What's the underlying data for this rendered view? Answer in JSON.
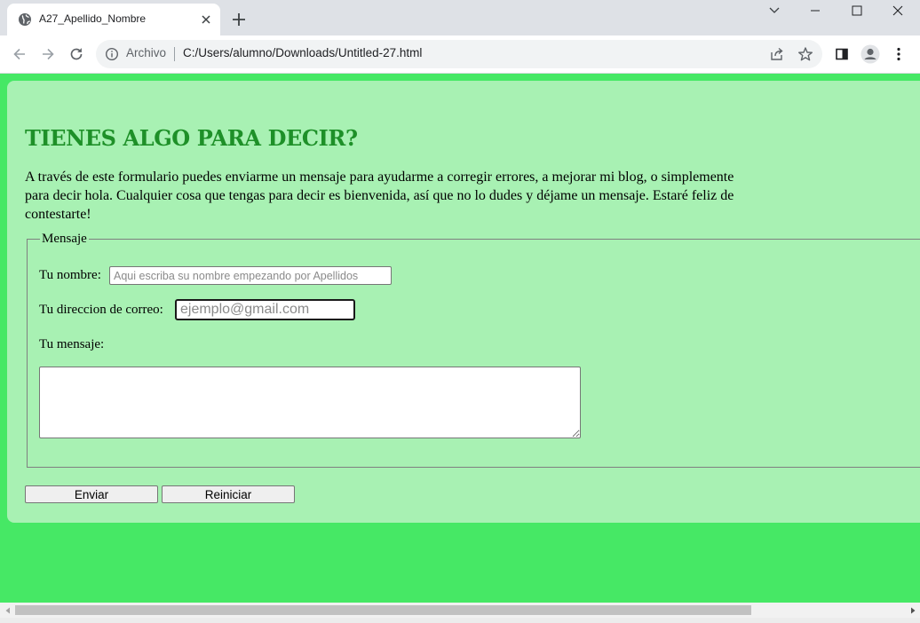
{
  "browser": {
    "tab_title": "A27_Apellido_Nombre",
    "address_scheme_label": "Archivo",
    "address_url": "C:/Users/alumno/Downloads/Untitled-27.html"
  },
  "page": {
    "heading": "TIENES ALGO PARA DECIR?",
    "intro": "A través de este formulario puedes enviarme un mensaje para ayudarme a corregir errores, a mejorar mi blog, o simplemente para decir hola. Cualquier cosa que tengas para decir es bienvenida, así que no lo dudes y déjame un mensaje. Estaré feliz de contestarte!",
    "form": {
      "legend": "Mensaje",
      "name_label": "Tu nombre:",
      "name_placeholder": "Aqui escriba su nombre empezando por Apellidos",
      "email_label": "Tu direccion de correo:",
      "email_placeholder": "ejemplo@gmail.com",
      "message_label": "Tu mensaje:",
      "submit_label": "Enviar",
      "reset_label": "Reiniciar"
    }
  },
  "colors": {
    "page_background": "#46e865",
    "card_background": "#a8f1b3",
    "heading": "#1e9028"
  }
}
